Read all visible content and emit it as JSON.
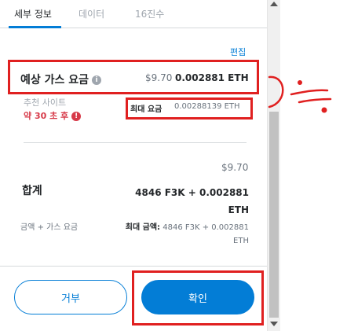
{
  "tabs": [
    {
      "label": "세부 정보"
    },
    {
      "label": "데이터"
    },
    {
      "label": "16진수"
    }
  ],
  "edit_link": "편집",
  "gas_fee": {
    "label": "예상 가스 요금",
    "usd": "$9.70",
    "eth": "0.002881 ETH"
  },
  "suggested_site": "추천 사이트",
  "timer": "약 30 초 후",
  "max_fee": {
    "label": "최대 요금",
    "value": "0.00288139 ETH"
  },
  "total": {
    "usd": "$9.70",
    "label": "합계",
    "amount_line1": "4846 F3K + 0.002881",
    "amount_line2": "ETH"
  },
  "amount_gas": {
    "label": "금액 + 가스 요금",
    "max_label": "최대 금액:",
    "max_value_line1": "4846 F3K + 0.002881",
    "max_value_line2": "ETH"
  },
  "buttons": {
    "reject": "거부",
    "confirm": "확인"
  },
  "colors": {
    "accent": "#037dd6",
    "annotation": "#e02020",
    "error": "#d73a49"
  },
  "icons": {
    "info": "info-icon",
    "timer": "alert-circle-icon"
  }
}
